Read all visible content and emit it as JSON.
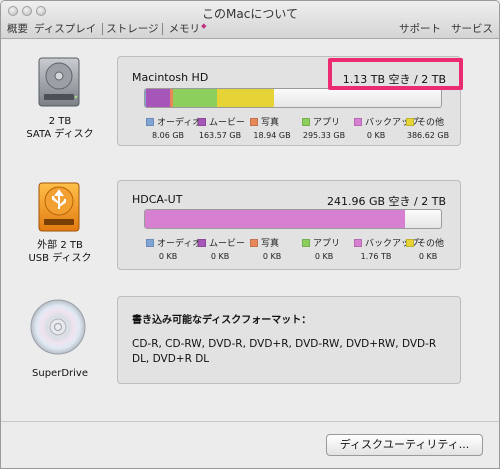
{
  "window": {
    "title": "このMacについて",
    "tabs_left": [
      "概要",
      "ディスプレイ",
      "ストレージ",
      "メモリ"
    ],
    "tabs_right": [
      "サポート",
      "サービス"
    ],
    "active_tab": "ストレージ"
  },
  "drives": [
    {
      "label_line1": "2 TB",
      "label_line2": "SATA ディスク",
      "icon": "hard-disk-icon",
      "name": "Macintosh HD",
      "free": "1.13 TB 空き / 2 TB",
      "usage": [
        {
          "category": "オーディオ",
          "color": "#7fa4d6",
          "value": "8.06 GB",
          "fraction": 0.003
        },
        {
          "category": "ムービー",
          "color": "#a656b8",
          "value": "163.57 GB",
          "fraction": 0.082
        },
        {
          "category": "写真",
          "color": "#e8885a",
          "value": "18.94 GB",
          "fraction": 0.009
        },
        {
          "category": "アプリ",
          "color": "#8ccf5c",
          "value": "295.33 GB",
          "fraction": 0.148
        },
        {
          "category": "バックアップ",
          "color": "#d77fd1",
          "value": "0 KB",
          "fraction": 0.0
        },
        {
          "category": "その他",
          "color": "#e6d436",
          "value": "386.62 GB",
          "fraction": 0.193
        }
      ]
    },
    {
      "label_line1": "外部 2 TB",
      "label_line2": "USB ディスク",
      "icon": "usb-drive-icon",
      "name": "HDCA-UT",
      "free": "241.96 GB 空き / 2 TB",
      "usage": [
        {
          "category": "オーディオ",
          "color": "#7fa4d6",
          "value": "0 KB",
          "fraction": 0.0
        },
        {
          "category": "ムービー",
          "color": "#a656b8",
          "value": "0 KB",
          "fraction": 0.0
        },
        {
          "category": "写真",
          "color": "#e8885a",
          "value": "0 KB",
          "fraction": 0.0
        },
        {
          "category": "アプリ",
          "color": "#8ccf5c",
          "value": "0 KB",
          "fraction": 0.0
        },
        {
          "category": "バックアップ",
          "color": "#d77fd1",
          "value": "1.76 TB",
          "fraction": 0.88
        },
        {
          "category": "その他",
          "color": "#e6d436",
          "value": "0 KB",
          "fraction": 0.0
        }
      ]
    }
  ],
  "superdrive": {
    "label": "SuperDrive",
    "icon": "optical-disc-icon",
    "formats_title": "書き込み可能なディスクフォーマット：",
    "formats": "CD-R, CD-RW, DVD-R, DVD+R, DVD-RW, DVD+RW, DVD-R DL, DVD+R DL"
  },
  "buttons": {
    "disk_utility": "ディスクユーティリティ..."
  },
  "colors": {
    "highlight": "#ec2a72"
  }
}
